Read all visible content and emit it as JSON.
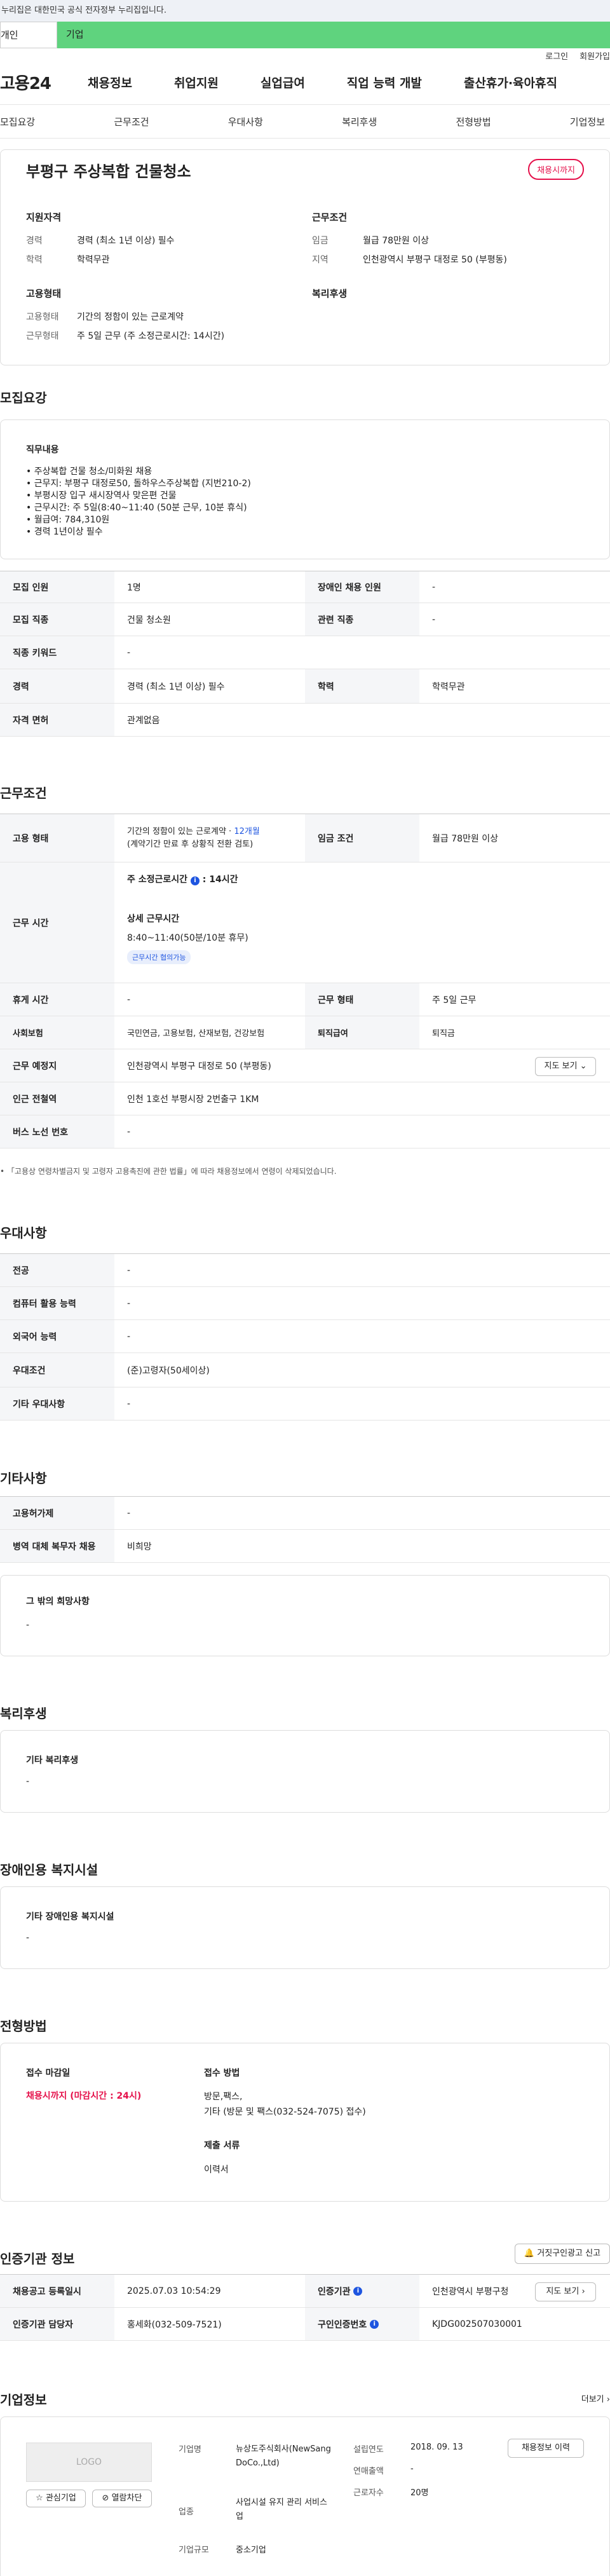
{
  "gov_banner": "이 누리집은 대한민국 공식 전자정부 누리집입니다.",
  "user_tabs": {
    "individual": "개인",
    "corporate": "기업"
  },
  "util_links": {
    "login": "로그인",
    "join": "회원가입"
  },
  "gnb": {
    "logo": "고용24",
    "items": [
      "채용정보",
      "취업지원",
      "실업급여",
      "직업 능력 개발",
      "출산휴가·육아휴직"
    ]
  },
  "subnav": [
    "모집요강",
    "근무조건",
    "우대사항",
    "복리후생",
    "전형방법",
    "기업정보"
  ],
  "summary": {
    "title": "부평구 주상복합 건물청소",
    "status_badge": "채용시까지",
    "qual_title": "지원자격",
    "qual": [
      {
        "k": "경력",
        "v": "경력 (최소 1년 이상) 필수"
      },
      {
        "k": "학력",
        "v": "학력무관"
      }
    ],
    "cond_title": "근무조건",
    "cond": [
      {
        "k": "임금",
        "v": "월급 78만원 이상"
      },
      {
        "k": "지역",
        "v": "인천광역시 부평구 대정로 50 (부평동)"
      }
    ],
    "emp_title": "고용형태",
    "emp": [
      {
        "k": "고용형태",
        "v": "기간의 정함이 있는 근로계약"
      },
      {
        "k": "근무형태",
        "v": "주 5일 근무 (주 소정근로시간: 14시간)"
      }
    ],
    "welfare_title": "복리후생"
  },
  "recruit": {
    "title": "모집요강",
    "duty_title": "직무내용",
    "duty_lines": [
      "• 주상복합 건물 청소/미화원 채용",
      "• 근무지: 부평구 대정로50, 돌하우스주상복합 (지번210-2)",
      "• 부평시장 입구 새시장역사 맞은편 건물",
      "• 근무시간: 주 5일(8:40~11:40 (50분 근무, 10분 휴식)",
      "• 월급여: 784,310원",
      "• 경력 1년이상 필수"
    ],
    "rows": [
      [
        {
          "th": "모집 인원",
          "td": "1명"
        },
        {
          "th": "장애인 채용 인원",
          "td": "-"
        }
      ],
      [
        {
          "th": "모집 직종",
          "td": "건물 청소원"
        },
        {
          "th": "관련 직종",
          "td": "-"
        }
      ],
      [
        {
          "th": "직종 키워드",
          "td": "-"
        }
      ],
      [
        {
          "th": "경력",
          "td": "경력 (최소 1년 이상) 필수"
        },
        {
          "th": "학력",
          "td": "학력무관"
        }
      ],
      [
        {
          "th": "자격 면허",
          "td": "관계없음"
        }
      ]
    ]
  },
  "work": {
    "title": "근무조건",
    "emp_type_th": "고용 형태",
    "emp_type_line1": "기간의 정함이 있는 근로계약 · ",
    "emp_type_months": "12개월",
    "emp_type_line2": "(계약기간 만료 후 상황직 전환 검토)",
    "wage_th": "임금 조건",
    "wage_td": "월급 78만원 이상",
    "hours_th": "근무 시간",
    "hours_weekly_label": "주 소정근로시간",
    "hours_weekly_value": ": 14시간",
    "hours_detail_title": "상세 근무시간",
    "hours_detail": "8:40~11:40(50분/10분 휴무)",
    "hours_pill": "근무시간 협의가능",
    "rows": [
      [
        {
          "th": "휴게 시간",
          "td": "-"
        },
        {
          "th": "근무 형태",
          "td": "주 5일 근무"
        }
      ],
      [
        {
          "th": "사회보험",
          "td": "국민연금, 고용보험, 산재보험, 건강보험"
        },
        {
          "th": "퇴직급여",
          "td": "퇴직금"
        }
      ]
    ],
    "addr_th": "근무 예정지",
    "addr_td": "인천광역시 부평구 대정로 50 (부평동)",
    "map_btn": "지도 보기",
    "station_th": "인근 전철역",
    "station_td": "인천 1호선 부평시장 2번출구 1KM",
    "bus_th": "버스 노선 번호",
    "bus_td": "-",
    "note": "「고용상 연령차별금지 및 고령자 고용촉진에 관한 법률」에 따라 채용정보에서 연령이 삭제되었습니다."
  },
  "pref": {
    "title": "우대사항",
    "rows": [
      {
        "th": "전공",
        "td": "-"
      },
      {
        "th": "컴퓨터 활용 능력",
        "td": "-"
      },
      {
        "th": "외국어 능력",
        "td": "-"
      },
      {
        "th": "우대조건",
        "td": "(준)고령자(50세이상)"
      },
      {
        "th": "기타 우대사항",
        "td": "-"
      }
    ]
  },
  "etc": {
    "title": "기타사항",
    "rows": [
      {
        "th": "고용허가제",
        "td": "-"
      },
      {
        "th": "병역 대체 복무자 채용",
        "td": "비희망"
      }
    ],
    "other_title": "그 밖의 희망사항",
    "other_value": "-"
  },
  "welfare": {
    "title": "복리후생",
    "box_title": "기타 복리후생",
    "box_value": "-"
  },
  "disab": {
    "title": "장애인용 복지시설",
    "box_title": "기타 장애인용 복지시설",
    "box_value": "-"
  },
  "screening": {
    "title": "전형방법",
    "deadline_title": "접수 마감일",
    "deadline_value": "채용시까지 (마감시간 : 24시)",
    "method_title": "접수 방법",
    "method_lines": [
      "방문,팩스,",
      "기타 (방문 및 팩스(032-524-7075) 접수)"
    ],
    "docs_title": "제출 서류",
    "docs_value": "이력서"
  },
  "cert": {
    "title": "인증기관 정보",
    "report_btn": "거짓구인광고 신고",
    "rows": [
      [
        {
          "th": "채용공고 등록일시",
          "td": "2025.07.03 10:54:29"
        },
        {
          "th": "인증기관",
          "td": "인천광역시 부평구청"
        }
      ],
      [
        {
          "th": "인증기관 담당자",
          "td": "홍세화(032-509-7521)"
        },
        {
          "th": "구인인증번호",
          "td": "KJDG002507030001"
        }
      ]
    ],
    "map_btn": "지도 보기"
  },
  "company": {
    "title": "기업정보",
    "more": "더보기",
    "logo_text": "LOGO",
    "fav_btn": "관심기업",
    "block_btn": "열람차단",
    "name_k": "기업명",
    "name_v": "뉴상도주식회사(NewSangDoCo.,Ltd)",
    "industry_k": "업종",
    "industry_v": "사업시설 유지 관리 서비스업",
    "size_k": "기업규모",
    "size_v": "중소기업",
    "founded_k": "설립연도",
    "founded_v": "2018. 09. 13",
    "sales_k": "연매출액",
    "sales_v": "-",
    "staff_k": "근로자수",
    "staff_v": "20명",
    "jobs_btn": "채용정보 이력"
  }
}
